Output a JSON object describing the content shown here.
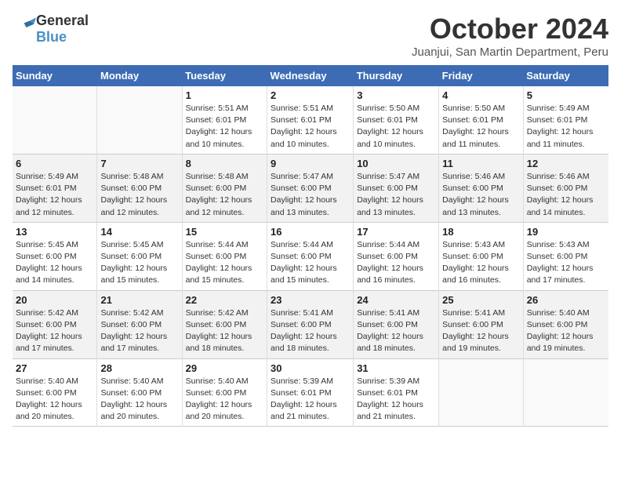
{
  "header": {
    "logo_line1": "General",
    "logo_line2": "Blue",
    "month": "October 2024",
    "location": "Juanjui, San Martin Department, Peru"
  },
  "days_of_week": [
    "Sunday",
    "Monday",
    "Tuesday",
    "Wednesday",
    "Thursday",
    "Friday",
    "Saturday"
  ],
  "weeks": [
    [
      {
        "day": "",
        "info": ""
      },
      {
        "day": "",
        "info": ""
      },
      {
        "day": "1",
        "info": "Sunrise: 5:51 AM\nSunset: 6:01 PM\nDaylight: 12 hours\nand 10 minutes."
      },
      {
        "day": "2",
        "info": "Sunrise: 5:51 AM\nSunset: 6:01 PM\nDaylight: 12 hours\nand 10 minutes."
      },
      {
        "day": "3",
        "info": "Sunrise: 5:50 AM\nSunset: 6:01 PM\nDaylight: 12 hours\nand 10 minutes."
      },
      {
        "day": "4",
        "info": "Sunrise: 5:50 AM\nSunset: 6:01 PM\nDaylight: 12 hours\nand 11 minutes."
      },
      {
        "day": "5",
        "info": "Sunrise: 5:49 AM\nSunset: 6:01 PM\nDaylight: 12 hours\nand 11 minutes."
      }
    ],
    [
      {
        "day": "6",
        "info": "Sunrise: 5:49 AM\nSunset: 6:01 PM\nDaylight: 12 hours\nand 12 minutes."
      },
      {
        "day": "7",
        "info": "Sunrise: 5:48 AM\nSunset: 6:00 PM\nDaylight: 12 hours\nand 12 minutes."
      },
      {
        "day": "8",
        "info": "Sunrise: 5:48 AM\nSunset: 6:00 PM\nDaylight: 12 hours\nand 12 minutes."
      },
      {
        "day": "9",
        "info": "Sunrise: 5:47 AM\nSunset: 6:00 PM\nDaylight: 12 hours\nand 13 minutes."
      },
      {
        "day": "10",
        "info": "Sunrise: 5:47 AM\nSunset: 6:00 PM\nDaylight: 12 hours\nand 13 minutes."
      },
      {
        "day": "11",
        "info": "Sunrise: 5:46 AM\nSunset: 6:00 PM\nDaylight: 12 hours\nand 13 minutes."
      },
      {
        "day": "12",
        "info": "Sunrise: 5:46 AM\nSunset: 6:00 PM\nDaylight: 12 hours\nand 14 minutes."
      }
    ],
    [
      {
        "day": "13",
        "info": "Sunrise: 5:45 AM\nSunset: 6:00 PM\nDaylight: 12 hours\nand 14 minutes."
      },
      {
        "day": "14",
        "info": "Sunrise: 5:45 AM\nSunset: 6:00 PM\nDaylight: 12 hours\nand 15 minutes."
      },
      {
        "day": "15",
        "info": "Sunrise: 5:44 AM\nSunset: 6:00 PM\nDaylight: 12 hours\nand 15 minutes."
      },
      {
        "day": "16",
        "info": "Sunrise: 5:44 AM\nSunset: 6:00 PM\nDaylight: 12 hours\nand 15 minutes."
      },
      {
        "day": "17",
        "info": "Sunrise: 5:44 AM\nSunset: 6:00 PM\nDaylight: 12 hours\nand 16 minutes."
      },
      {
        "day": "18",
        "info": "Sunrise: 5:43 AM\nSunset: 6:00 PM\nDaylight: 12 hours\nand 16 minutes."
      },
      {
        "day": "19",
        "info": "Sunrise: 5:43 AM\nSunset: 6:00 PM\nDaylight: 12 hours\nand 17 minutes."
      }
    ],
    [
      {
        "day": "20",
        "info": "Sunrise: 5:42 AM\nSunset: 6:00 PM\nDaylight: 12 hours\nand 17 minutes."
      },
      {
        "day": "21",
        "info": "Sunrise: 5:42 AM\nSunset: 6:00 PM\nDaylight: 12 hours\nand 17 minutes."
      },
      {
        "day": "22",
        "info": "Sunrise: 5:42 AM\nSunset: 6:00 PM\nDaylight: 12 hours\nand 18 minutes."
      },
      {
        "day": "23",
        "info": "Sunrise: 5:41 AM\nSunset: 6:00 PM\nDaylight: 12 hours\nand 18 minutes."
      },
      {
        "day": "24",
        "info": "Sunrise: 5:41 AM\nSunset: 6:00 PM\nDaylight: 12 hours\nand 18 minutes."
      },
      {
        "day": "25",
        "info": "Sunrise: 5:41 AM\nSunset: 6:00 PM\nDaylight: 12 hours\nand 19 minutes."
      },
      {
        "day": "26",
        "info": "Sunrise: 5:40 AM\nSunset: 6:00 PM\nDaylight: 12 hours\nand 19 minutes."
      }
    ],
    [
      {
        "day": "27",
        "info": "Sunrise: 5:40 AM\nSunset: 6:00 PM\nDaylight: 12 hours\nand 20 minutes."
      },
      {
        "day": "28",
        "info": "Sunrise: 5:40 AM\nSunset: 6:00 PM\nDaylight: 12 hours\nand 20 minutes."
      },
      {
        "day": "29",
        "info": "Sunrise: 5:40 AM\nSunset: 6:00 PM\nDaylight: 12 hours\nand 20 minutes."
      },
      {
        "day": "30",
        "info": "Sunrise: 5:39 AM\nSunset: 6:01 PM\nDaylight: 12 hours\nand 21 minutes."
      },
      {
        "day": "31",
        "info": "Sunrise: 5:39 AM\nSunset: 6:01 PM\nDaylight: 12 hours\nand 21 minutes."
      },
      {
        "day": "",
        "info": ""
      },
      {
        "day": "",
        "info": ""
      }
    ]
  ]
}
